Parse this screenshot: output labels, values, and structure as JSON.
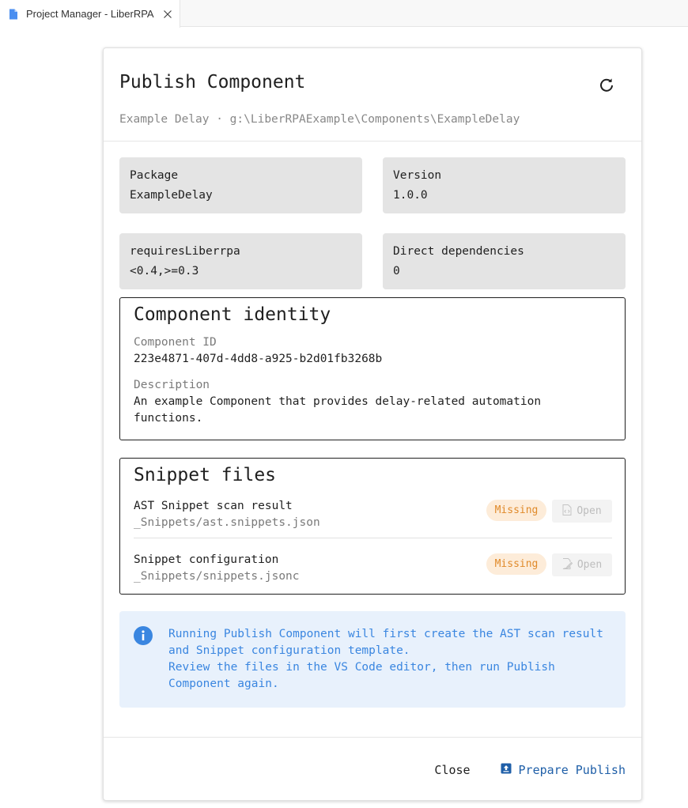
{
  "tab": {
    "title": "Project Manager - LiberRPA",
    "file_icon": "file-icon",
    "close_icon": "close-icon"
  },
  "header": {
    "title": "Publish Component",
    "subtitle": "Example Delay · g:\\LiberRPAExample\\Components\\ExampleDelay",
    "refresh_icon": "refresh-icon"
  },
  "info": {
    "package_label": "Package",
    "package_value": "ExampleDelay",
    "version_label": "Version",
    "version_value": "1.0.0",
    "requires_label": "requiresLiberrpa",
    "requires_value": "<0.4,>=0.3",
    "deps_label": "Direct dependencies",
    "deps_value": "0"
  },
  "identity": {
    "title": "Component identity",
    "id_label": "Component ID",
    "id_value": "223e4871-407d-4dd8-a925-b2d01fb3268b",
    "description_label": "Description",
    "description_value": "An example Component that provides delay-related automation functions."
  },
  "snippets": {
    "title": "Snippet files",
    "rows": [
      {
        "name": "AST Snippet scan result",
        "path": "_Snippets/ast.snippets.json",
        "status": "Missing",
        "open_label": "Open",
        "icon": "file-code-icon"
      },
      {
        "name": "Snippet configuration",
        "path": "_Snippets/snippets.jsonc",
        "status": "Missing",
        "open_label": "Open",
        "icon": "file-edit-icon"
      }
    ]
  },
  "alert": {
    "icon": "info-icon",
    "line1": "Running Publish Component will first create the AST scan result and Snippet configuration template.",
    "line2": "Review the files in the VS Code editor, then run Publish Component again."
  },
  "footer": {
    "close_label": "Close",
    "publish_label": "Prepare Publish",
    "publish_icon": "upload-box-icon"
  },
  "colors": {
    "status_bg": "#fdecd9",
    "status_text": "#e08a2a",
    "alert_bg": "#e8f1fc",
    "alert_text": "#3a86e0",
    "primary": "#1f5fa8",
    "info_box_bg": "#e4e4e4"
  }
}
